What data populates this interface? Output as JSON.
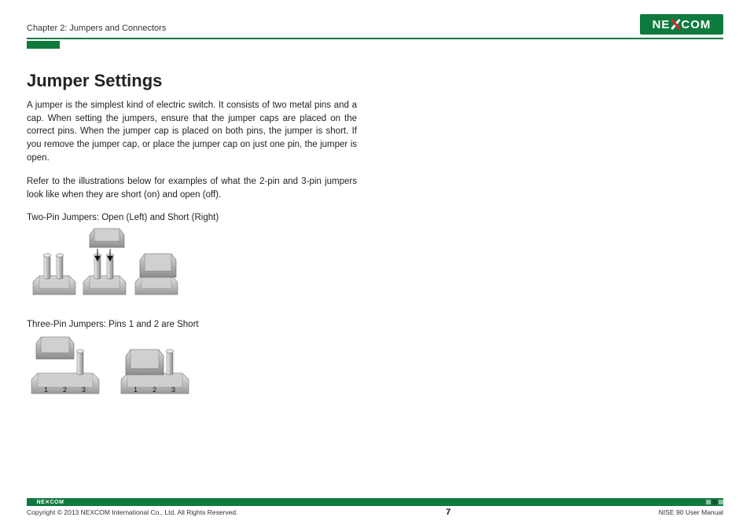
{
  "header": {
    "chapter": "Chapter 2: Jumpers and Connectors",
    "brand_left": "NE",
    "brand_right": "COM"
  },
  "body": {
    "title": "Jumper Settings",
    "p1": "A jumper is the simplest kind of electric switch. It consists of two metal pins and a cap. When setting the jumpers, ensure that the jumper caps are placed on the correct pins. When the jumper cap is placed on both pins, the jumper is short. If you remove the jumper cap, or place the jumper cap on just one pin, the jumper is open.",
    "p2": "Refer to the illustrations below for examples of what the 2-pin and 3-pin jumpers look like when they are short (on) and open (off).",
    "cap1": "Two-Pin Jumpers: Open (Left) and Short (Right)",
    "cap2": "Three-Pin Jumpers: Pins 1 and 2 are Short",
    "pin_labels": {
      "one": "1",
      "two": "2",
      "three": "3"
    }
  },
  "footer": {
    "brand": "NE✕COM",
    "copyright": "Copyright © 2013 NEXCOM International Co., Ltd. All Rights Reserved.",
    "page": "7",
    "manual": "NISE 90 User Manual"
  },
  "colors": {
    "brand_green": "#0f7a3d",
    "brand_red": "#d8262f"
  }
}
